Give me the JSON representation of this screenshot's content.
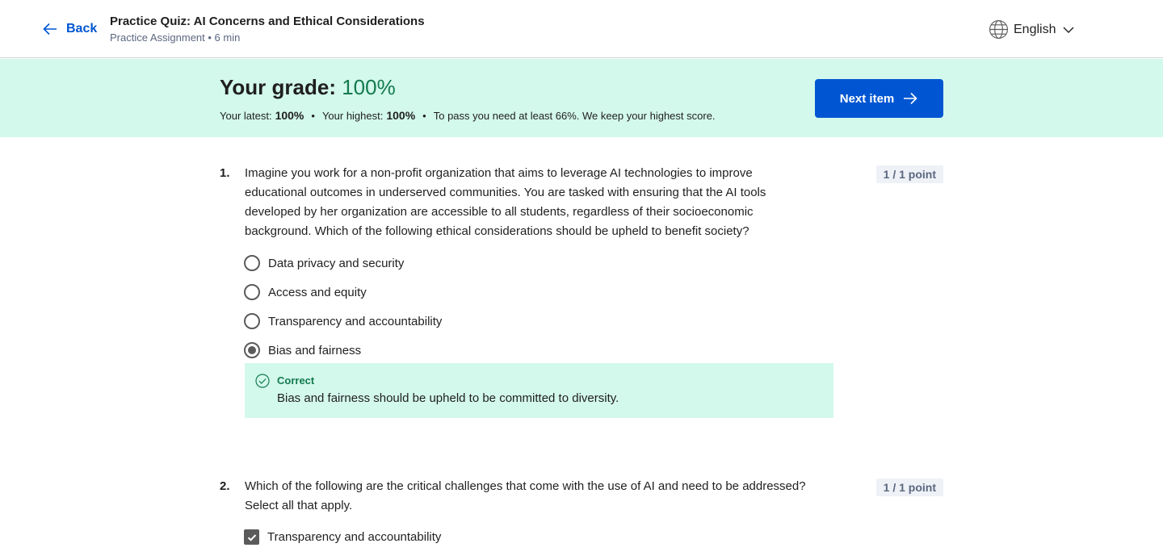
{
  "header": {
    "back_label": "Back",
    "quiz_title": "Practice Quiz: AI Concerns and Ethical Considerations",
    "quiz_meta": "Practice Assignment • 6 min",
    "language": "English"
  },
  "grade": {
    "title_prefix": "Your grade: ",
    "value": "100%",
    "latest_label": "Your latest:",
    "latest_value": "100%",
    "highest_label": "Your highest:",
    "highest_value": "100%",
    "pass_note": "To pass you need at least 66%. We keep your highest score.",
    "separator": "•",
    "next_button": "Next item"
  },
  "questions": [
    {
      "number": "1.",
      "text": "Imagine you work for a non-profit organization that aims to leverage AI technologies to improve educational outcomes in underserved communities. You are tasked with ensuring that the AI tools developed by her organization are accessible to all students, regardless of their socioeconomic background. Which of the following ethical considerations should be upheld to benefit society?",
      "points": "1 / 1 point",
      "options": [
        {
          "label": "Data privacy and security",
          "selected": false
        },
        {
          "label": "Access and equity",
          "selected": false
        },
        {
          "label": "Transparency and accountability",
          "selected": false
        },
        {
          "label": "Bias and fairness",
          "selected": true
        }
      ],
      "feedback": {
        "label": "Correct",
        "text": "Bias and fairness should be upheld to be committed to diversity."
      }
    },
    {
      "number": "2.",
      "text": "Which of the following are the critical challenges that come with the use of AI and need to be addressed? Select all that apply.",
      "points": "1 / 1 point",
      "options": [
        {
          "label": "Transparency and accountability",
          "selected": true
        }
      ]
    }
  ],
  "colors": {
    "accent": "#0056d2",
    "success": "#137a4e",
    "success_bg": "#d3f8ec"
  }
}
